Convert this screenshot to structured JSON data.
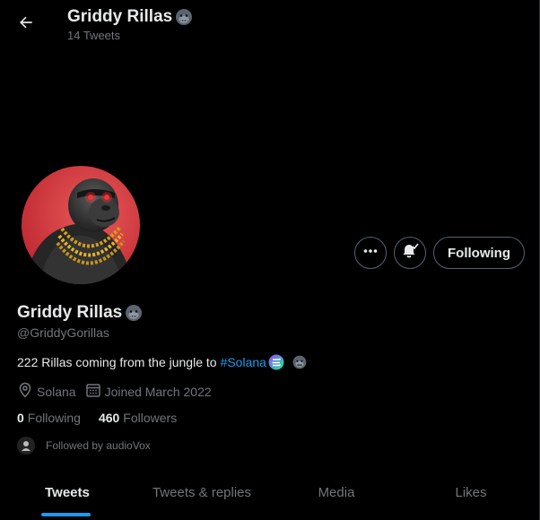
{
  "header": {
    "name": "Griddy Rillas",
    "tweet_count": "14 Tweets",
    "back_icon": "arrow-left-icon"
  },
  "profile": {
    "name": "Griddy Rillas",
    "handle": "@GriddyGorillas",
    "name_emoji": "gorilla-icon",
    "bio_text": "222 Rillas coming from the jungle to",
    "bio_hashtag": "#Solana",
    "location": "Solana",
    "joined": "Joined March 2022",
    "following_count": "0",
    "following_label": "Following",
    "followers_count": "460",
    "followers_label": "Followers",
    "followed_by": "Followed by audioVox"
  },
  "actions": {
    "more_icon": "ellipsis-icon",
    "notification_icon": "bell-check-icon",
    "follow_label": "Following"
  },
  "tabs": [
    {
      "label": "Tweets",
      "active": true
    },
    {
      "label": "Tweets & replies",
      "active": false
    },
    {
      "label": "Media",
      "active": false
    },
    {
      "label": "Likes",
      "active": false
    }
  ],
  "colors": {
    "background": "#000000",
    "text": "#e7e9ea",
    "secondary": "#71767b",
    "accent": "#1d9bf0",
    "border": "#536471",
    "avatar_bg": "#d7263d"
  }
}
